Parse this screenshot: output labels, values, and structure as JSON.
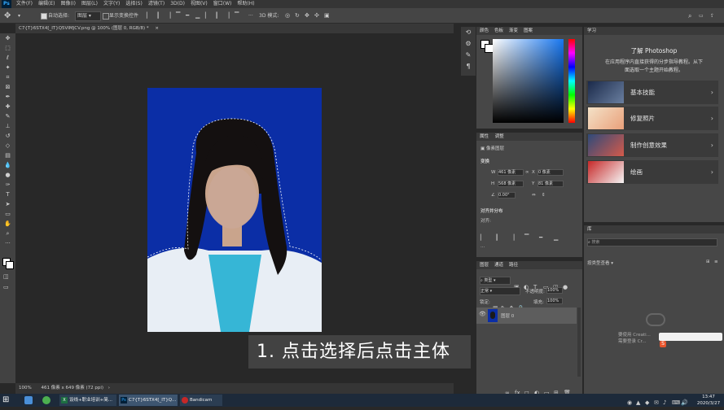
{
  "menubar": {
    "ps_label": "Ps",
    "items": [
      "文件(F)",
      "编辑(E)",
      "图像(I)",
      "图层(L)",
      "文字(Y)",
      "选择(S)",
      "滤镜(T)",
      "3D(D)",
      "视图(V)",
      "窗口(W)",
      "帮助(H)"
    ]
  },
  "options": {
    "auto_select_label": "自动选择:",
    "layer_option": "图层",
    "show_transform_label": "显示变换控件",
    "mode_3d": "3D 模式:"
  },
  "document": {
    "tab_title": "C7{T}6STX4[_IT}Q5VIMJCV.png @ 100% (图层 0, RGB/8) *"
  },
  "status": {
    "zoom": "100%",
    "doc_info": "461 像素 x 649 像素 (72 ppi)"
  },
  "caption": "1. 点击选择后点击主体",
  "color_panel": {
    "tabs": [
      "颜色",
      "色板",
      "渐变",
      "图案"
    ]
  },
  "properties_panel": {
    "tabs": [
      "属性",
      "调整"
    ],
    "pixel_layer_label": "像素图层",
    "transform_label": "变换",
    "w_value": "461 像素",
    "h_value": "568 像素",
    "x_value": "0 像素",
    "y_value": "81 像素",
    "angle_value": "0.00°",
    "align_label": "对齐并分布",
    "align_sub": "对齐:"
  },
  "layers_panel": {
    "tabs": [
      "图层",
      "通道",
      "路径"
    ],
    "kind_label": "类型",
    "blend_mode": "正常",
    "opacity_label": "不透明度:",
    "opacity_value": "100%",
    "lock_label": "锁定:",
    "fill_label": "填充:",
    "fill_value": "100%",
    "layer_name": "图层 0"
  },
  "learn_panel": {
    "tab": "学习",
    "title": "了解 Photoshop",
    "subtitle_line1": "在应用程序内直接获得的分步指导教程。从下",
    "subtitle_line2": "面选取一个主题开始教程。",
    "items": [
      {
        "label": "基本技能"
      },
      {
        "label": "修复照片"
      },
      {
        "label": "制作创意效果"
      },
      {
        "label": "绘画"
      }
    ]
  },
  "libraries_panel": {
    "tab": "库",
    "search_placeholder": "搜索",
    "view_label": "按类型查看"
  },
  "watermark": {
    "line1": "要使用 Creati...",
    "line2": "需要登录 Cr..."
  },
  "taskbar": {
    "items": [
      {
        "label": "设线+职业培训+简..."
      },
      {
        "label": "C7{T}6STX4[_IT}Q..."
      },
      {
        "label": "Bandicam"
      }
    ],
    "time": "13:47",
    "date": "2020/3/27"
  },
  "colors": {
    "photo_bg": "#0b2ea6",
    "accent": "#31a8ff"
  }
}
